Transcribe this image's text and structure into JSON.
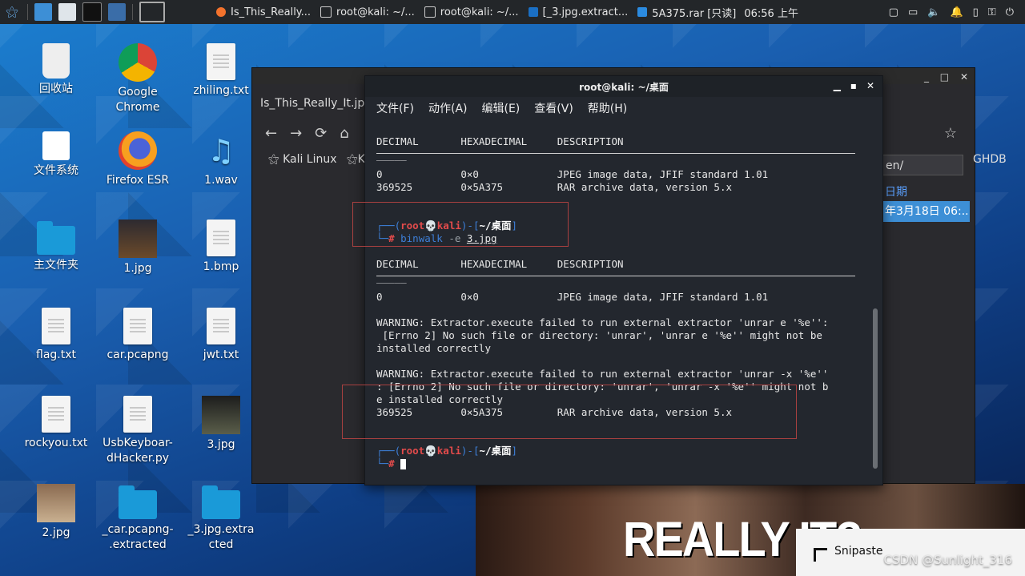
{
  "taskbar": {
    "tasks": [
      {
        "label": "Is_This_Really..."
      },
      {
        "label": "root@kali: ~/..."
      },
      {
        "label": "root@kali: ~/..."
      },
      {
        "label": "[_3.jpg.extract..."
      },
      {
        "label": "5A375.rar [只读]"
      }
    ],
    "clock": "06:56 上午"
  },
  "desktop": {
    "icons": [
      {
        "label": "回收站"
      },
      {
        "label": "Google\nChrome"
      },
      {
        "label": "zhiling.txt"
      },
      {
        "label": "文件系统"
      },
      {
        "label": "Firefox ESR"
      },
      {
        "label": "1.wav"
      },
      {
        "label": "主文件夹"
      },
      {
        "label": "1.jpg"
      },
      {
        "label": "1.bmp"
      },
      {
        "label": "flag.txt"
      },
      {
        "label": "car.pcapng"
      },
      {
        "label": "jwt.txt"
      },
      {
        "label": "rockyou.txt"
      },
      {
        "label": "UsbKeyboar-\ndHacker.py"
      },
      {
        "label": "3.jpg"
      },
      {
        "label": "2.jpg"
      },
      {
        "label": "_car.pcapng-\n.extracted"
      },
      {
        "label": "_3.jpg.extra\ncted"
      }
    ]
  },
  "firefox": {
    "tab": "Is_This_Really_It.jp",
    "bookmark": "Kali Linux",
    "bookmark2": "K",
    "url_fragment": "en/",
    "col_header": "日期",
    "selected_row": "年3月18日 06:..",
    "ghdb": "GHDB",
    "meme_text": "REALLY IT?"
  },
  "terminal": {
    "title": "root@kali: ~/桌面",
    "menu": [
      "文件(F)",
      "动作(A)",
      "编辑(E)",
      "查看(V)",
      "帮助(H)"
    ],
    "header1": "DECIMAL       HEXADECIMAL     DESCRIPTION",
    "rule": "_____",
    "row1": "0             0×0             JPEG image data, JFIF standard 1.01",
    "row2": "369525        0×5A375         RAR archive data, version 5.x",
    "prompt_user": "root💀kali",
    "prompt_dir": "~/桌面",
    "cmd": "binwalk",
    "cmd_flag": " -e ",
    "cmd_arg": "3.jpg",
    "header2": "DECIMAL       HEXADECIMAL     DESCRIPTION",
    "row3": "0             0×0             JPEG image data, JFIF standard 1.01",
    "warn1a": "WARNING: Extractor.execute failed to run external extractor 'unrar e '%e'':",
    "warn1b": " [Errno 2] No such file or directory: 'unrar', 'unrar e '%e'' might not be",
    "warn1c": "installed correctly",
    "warn2a": "WARNING: Extractor.execute failed to run external extractor 'unrar -x '%e''",
    "warn2b": ": [Errno 2] No such file or directory: 'unrar', 'unrar -x '%e'' might not b",
    "warn2c": "e installed correctly",
    "row4": "369525        0×5A375         RAR archive data, version 5.x"
  },
  "snipaste": {
    "label": "Snipaste"
  },
  "watermark": "CSDN @Sunlight_316"
}
